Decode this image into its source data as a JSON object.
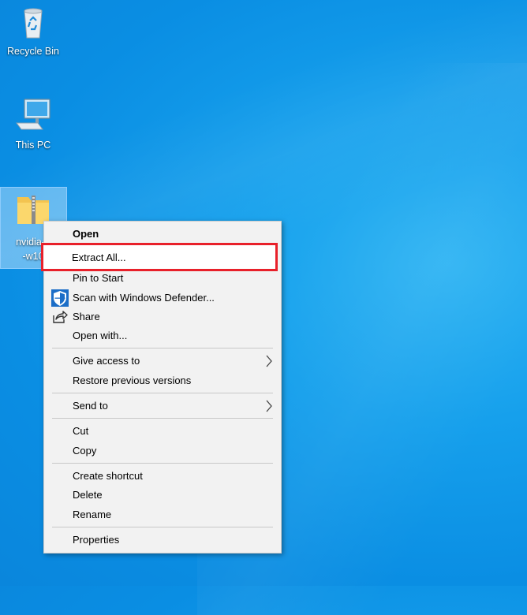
{
  "desktop": {
    "icons": [
      {
        "label": "Recycle Bin",
        "icon": "recycle-bin-icon"
      },
      {
        "label": "This PC",
        "icon": "computer-icon"
      },
      {
        "label_line1": "nvidia-4",
        "label_line2": "-w10",
        "icon": "zip-folder-icon"
      }
    ]
  },
  "context_menu": {
    "items": [
      {
        "label": "Open"
      },
      {
        "label": "Extract All..."
      },
      {
        "label": "Pin to Start"
      },
      {
        "label": "Scan with Windows Defender...",
        "icon": "windows-defender-icon"
      },
      {
        "label": "Share",
        "icon": "share-icon"
      },
      {
        "label": "Open with..."
      },
      {
        "label": "Give access to"
      },
      {
        "label": "Restore previous versions"
      },
      {
        "label": "Send to"
      },
      {
        "label": "Cut"
      },
      {
        "label": "Copy"
      },
      {
        "label": "Create shortcut"
      },
      {
        "label": "Delete"
      },
      {
        "label": "Rename"
      },
      {
        "label": "Properties"
      }
    ]
  },
  "colors": {
    "desktop_blue": "#0a8ee3",
    "highlight_red": "#e8202a",
    "menu_background": "#f2f2f2"
  }
}
